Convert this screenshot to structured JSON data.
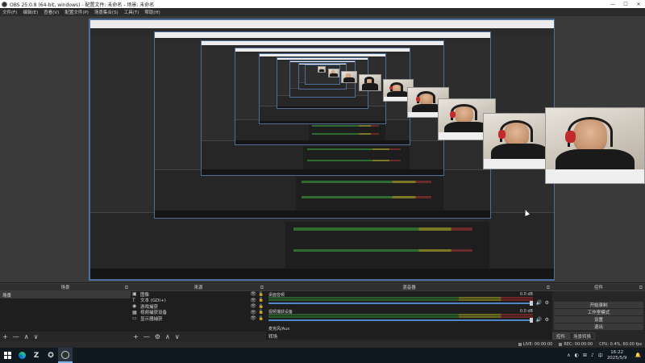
{
  "window": {
    "title": "OBS 25.0.8 (64-bit, windows) - 配置文件: 未命名 - 场景: 未命名",
    "minimize": "—",
    "maximize": "☐",
    "close": "✕"
  },
  "menu": [
    "文件(F)",
    "编辑(E)",
    "查看(V)",
    "配置文件(P)",
    "场景集合(S)",
    "工具(T)",
    "帮助(H)"
  ],
  "docks": {
    "scenes": {
      "title": "场景",
      "items": [
        "场景"
      ],
      "footer": [
        "+",
        "—",
        "∧",
        "∨"
      ]
    },
    "sources": {
      "title": "来源",
      "items": [
        {
          "icon": "▣",
          "label": "图像"
        },
        {
          "icon": "T",
          "label": "文本 (GDI+)"
        },
        {
          "icon": "◉",
          "label": "游戏捕获"
        },
        {
          "icon": "▦",
          "label": "视频捕获设备"
        },
        {
          "icon": "▭",
          "label": "显示器捕获"
        }
      ],
      "footer": [
        "+",
        "—",
        "⚙",
        "∧",
        "∨"
      ]
    },
    "mixer": {
      "title": "混音器",
      "channels": [
        {
          "name": "桌面音频",
          "db": "0.0 dB"
        },
        {
          "name": "视频捕获设备",
          "db": "0.0 dB"
        }
      ],
      "next_channel": "麦克风/Aux"
    },
    "controls": {
      "title": "控件",
      "buttons": [
        "开始录制",
        "工作室模式",
        "设置",
        "退出"
      ]
    }
  },
  "bottom_tabs": {
    "left": "转场",
    "right": [
      "控件",
      "场景转换"
    ]
  },
  "status": {
    "live": "LIVE: 00:00:00",
    "rec": "REC: 00:00:00",
    "cpu": "CPU: 0.4%, 60.00 fps"
  },
  "taskbar": {
    "time": "16:22",
    "date": "2025/5/9",
    "tray_icons": [
      "∧",
      "◐",
      "⊞",
      "♪",
      "中",
      "🔔"
    ]
  }
}
